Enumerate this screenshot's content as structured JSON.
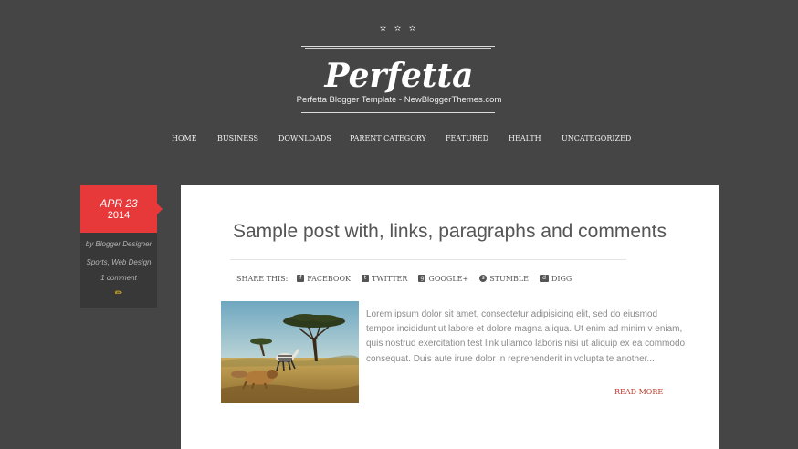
{
  "header": {
    "stars": "✫ ✫ ✫",
    "logo": "Perfetta",
    "tagline": "Perfetta Blogger Template - NewBloggerThemes.com"
  },
  "nav": {
    "items": [
      {
        "label": "HOME"
      },
      {
        "label": "BUSINESS"
      },
      {
        "label": "DOWNLOADS"
      },
      {
        "label": "PARENT CATEGORY"
      },
      {
        "label": "FEATURED"
      },
      {
        "label": "HEALTH"
      },
      {
        "label": "UNCATEGORIZED"
      }
    ]
  },
  "post": {
    "date": {
      "month_day": "APR 23",
      "year": "2014"
    },
    "meta": {
      "author": "by Blogger Designer",
      "labels": "Sports, Web Design",
      "comments": "1 comment"
    },
    "title": "Sample post with, links, paragraphs and comments",
    "share": {
      "label": "SHARE THIS:",
      "items": [
        {
          "label": "FACEBOOK",
          "icon": "facebook-icon"
        },
        {
          "label": "TWITTER",
          "icon": "twitter-icon"
        },
        {
          "label": "GOOGLE+",
          "icon": "google-plus-icon"
        },
        {
          "label": "STUMBLE",
          "icon": "stumbleupon-icon"
        },
        {
          "label": "DIGG",
          "icon": "digg-icon"
        }
      ]
    },
    "excerpt": "Lorem ipsum dolor sit amet, consectetur adipisicing elit, sed do eiusmod tempor incididunt ut labore et dolore magna aliqua. Ut enim ad minim v eniam, quis nostrud exercitation test link ullamco laboris nisi ut aliquip ex ea commodo consequat. Duis aute irure dolor in reprehenderit in volupta te another...",
    "read_more": "READ MORE"
  },
  "colors": {
    "background": "#454545",
    "accent": "#e8393a",
    "meta_box": "#383838",
    "card": "#ffffff",
    "read_more": "#c0392b"
  }
}
